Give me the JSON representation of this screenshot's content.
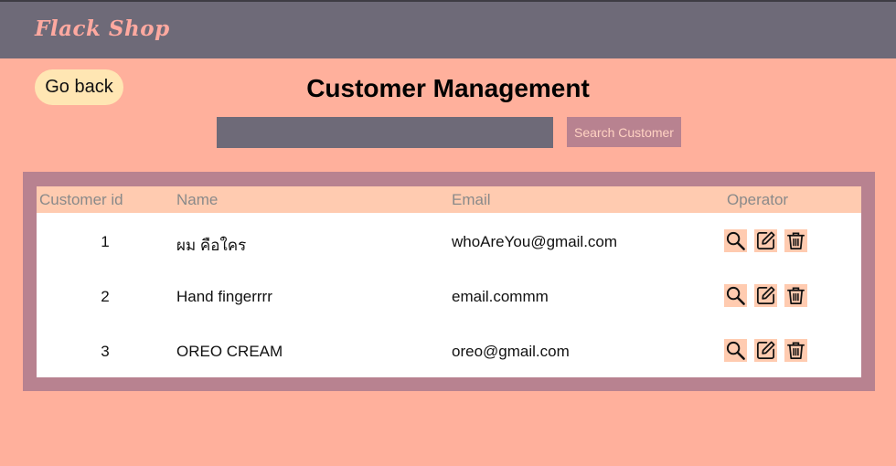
{
  "header": {
    "brand": "Flack Shop"
  },
  "actions": {
    "back_label": "Go back"
  },
  "page": {
    "title": "Customer Management"
  },
  "search": {
    "value": "",
    "placeholder": "",
    "button_label": "Search Customer"
  },
  "table": {
    "columns": [
      "Customer id",
      "Name",
      "Email",
      "Operator"
    ],
    "rows": [
      {
        "id": "1",
        "name": "ผม คือใคร",
        "email": "whoAreYou@gmail.com"
      },
      {
        "id": "2",
        "name": "Hand fingerrrr",
        "email": "email.commm"
      },
      {
        "id": "3",
        "name": "OREO CREAM",
        "email": "oreo@gmail.com"
      }
    ],
    "operator_icons": [
      "magnifier-icon",
      "edit-icon",
      "trash-icon"
    ]
  },
  "colors": {
    "page_bg": "#ffb09c",
    "topbar": "#6e6a78",
    "brand_text": "#ffa9a0",
    "back_button": "#ffe6b3",
    "table_frame": "#b88290",
    "table_header": "#ffcbb0"
  }
}
